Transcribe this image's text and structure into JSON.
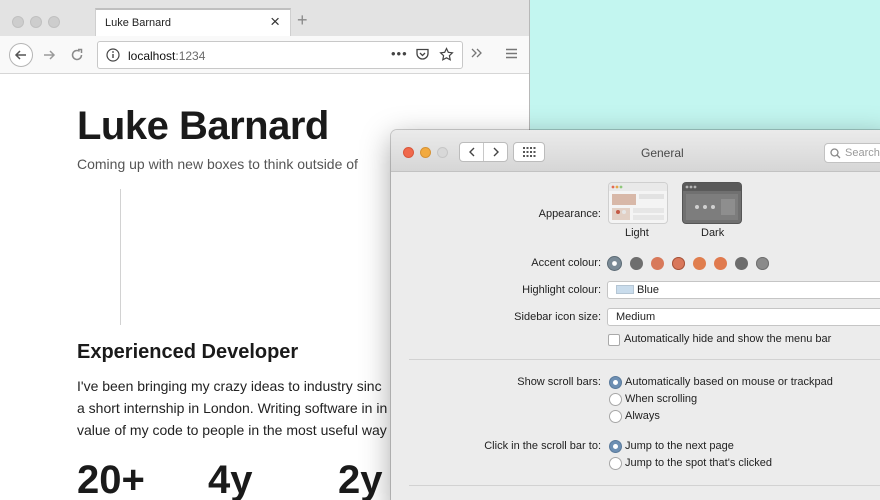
{
  "browser": {
    "tab_title": "Luke Barnard",
    "tab_close": "×",
    "new_tab": "+",
    "url_host": "localhost",
    "url_port": ":1234",
    "url_dots": "•••"
  },
  "page": {
    "title": "Luke Barnard",
    "subtitle": "Coming up with new boxes to think outside of",
    "heading": "Experienced Developer",
    "paragraph_lines": [
      "I've been bringing my crazy ideas to industry sinc",
      "a short internship in London. Writing software in in",
      "value of my code to people in the most useful way"
    ],
    "stats": [
      "20+",
      "4y",
      "2y"
    ]
  },
  "prefs": {
    "title": "General",
    "search_placeholder": "Search",
    "appearance": {
      "label": "Appearance:",
      "options": [
        "Light",
        "Dark"
      ]
    },
    "accent": {
      "label": "Accent colour:",
      "swatches": [
        "#7a8a96",
        "#6e6e6e",
        "#d8795a",
        "#d9775a",
        "#e07e4e",
        "#e07a4e",
        "#6c6c6c",
        "#8a8a8a"
      ]
    },
    "highlight": {
      "label": "Highlight colour:",
      "value": "Blue"
    },
    "sidebar_icon": {
      "label": "Sidebar icon size:",
      "value": "Medium"
    },
    "menu_bar_checkbox": "Automatically hide and show the menu bar",
    "scroll_bars": {
      "label": "Show scroll bars:",
      "options": [
        "Automatically based on mouse or trackpad",
        "When scrolling",
        "Always"
      ]
    },
    "click_scroll": {
      "label": "Click in the scroll bar to:",
      "options": [
        "Jump to the next page",
        "Jump to the spot that's clicked"
      ]
    }
  },
  "colors": {
    "desktop": "#c3f6f0",
    "close": "#f0694c",
    "minimize": "#f2aa3f"
  }
}
